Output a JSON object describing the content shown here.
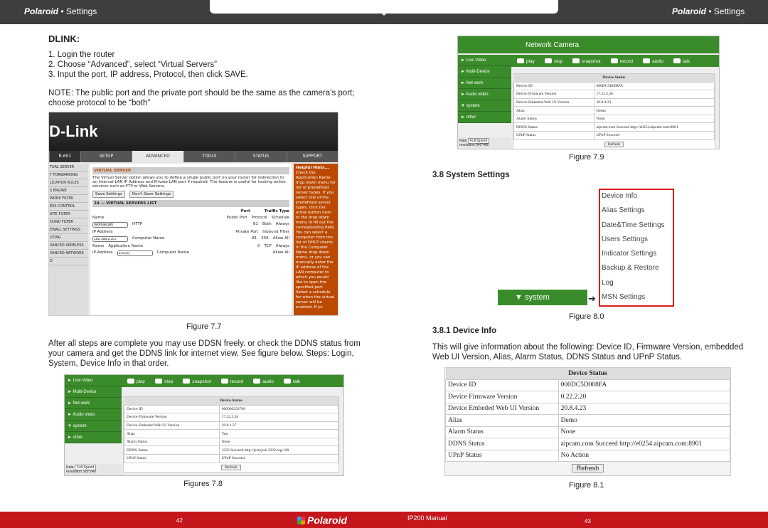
{
  "header": {
    "brand_left": "Polaroid",
    "settings_left": "Settings",
    "brand_right": "Polaroid",
    "settings_right": "Settings"
  },
  "left": {
    "title": "DLINK:",
    "steps": [
      "1. Login the router",
      "2. Choose “Advanced”, select “Virtual Servers”",
      "3. Input the port, IP address, Protocol, then click SAVE."
    ],
    "note": "NOTE: The public port and the private port should be the same as the camera’s port; choose protocol to be “both”",
    "fig77_caption": "Figure 7.7",
    "para": "After all steps are complete you may use DDSN freely. or check the DDNS status from your camera and get the DDNS link for internet view. See figure below. Steps: Login, System, Device Info in that order.",
    "fig78_caption": "Figures 7.8"
  },
  "dlink": {
    "logo": "D-Link",
    "model": "R-601",
    "nav": [
      "SETUP",
      "ADVANCED",
      "TOOLS",
      "STATUS",
      "SUPPORT"
    ],
    "side": [
      "TUAL SERVER",
      "T FORWARDING",
      "LICATION RULES",
      "S ENGINE",
      "WORK FILTER",
      "ESS CONTROL",
      "SITE FILTER",
      "OUND FILTER",
      "EWALL SETTINGS",
      "UTING",
      "VANCED WIRELESS",
      "VANCED NETWORK",
      "D"
    ],
    "section": "VIRTUAL SERVER",
    "desc": "The Virtual Server option allows you to define a single public port on your router for redirection to an internal LAN IP Address and Private LAN port if required. The feature is useful for hosting online services such as FTP or Web Servers.",
    "save_btn": "Save Settings",
    "dont_btn": "Don't Save Settings",
    "list_title": "24 — VIRTUAL SERVERS LIST",
    "col_port": "Port",
    "col_traffic": "Traffic Type",
    "name_label": "Name",
    "name_value": "rivomaxcam",
    "http": "HTTP",
    "ip_label": "IP Address",
    "ip_value": "192.168.0.107",
    "ip_value2": "0.0.0.0",
    "computer_name": "Computer Name",
    "application_name": "Application Name",
    "public_port": "Public Port",
    "private_port": "Private Port",
    "protocol": "Protocol",
    "schedule": "Schedule",
    "inbound": "Inbound Filter",
    "port_81": "81",
    "port_0": "0",
    "proto_both": "Both",
    "proto_tcp": "TCP",
    "proto_num": "256",
    "sched_always": "Always",
    "allow_all": "Allow All",
    "hints_title": "Helpful Hints...",
    "hints": "Check the Application Name drop down menu for list of predefined server types. If you select one of the predefined server types, click the arrow button next to the drop down menu to fill out the corresponding field. You can select a computer from the list of DHCP clients in the Computer Name drop down menu, or you can manually enter the IP address of the LAN computer to which you would like to open the specified port. Select a schedule for when the virtual server will be enabled. If yo"
  },
  "right": {
    "fig79_caption": "Figure 7.9",
    "sys_heading": "3.8 System Settings",
    "fig80_caption": "Figure 8.0",
    "devinfo_heading": "3.8.1 Device Info",
    "devinfo_para": "This will give information about the following: Device ID, Firmware Version, embedded Web UI Version, Alias, Alarm Status, DDNS Status and UPnP Status.",
    "fig81_caption": "Figure 8.1"
  },
  "camera": {
    "title": "Network Camera",
    "toolbar": [
      "play",
      "stop",
      "snapshot",
      "record",
      "audio",
      "talk"
    ],
    "menu": [
      "► Live Video",
      "► Multi-Device",
      "► Net work",
      "► Audio video",
      "▼ system",
      "► other"
    ],
    "rate_label": "Rate",
    "rate_value": "Full-Speed",
    "resolution_label": "resolution",
    "res_79": "640*480",
    "res_78": "320*240"
  },
  "status_79": {
    "title": "Device Status",
    "rows": [
      [
        "Device ID",
        "000DC5D008FA"
      ],
      [
        "Device Firmware Version",
        "17.22.2.26"
      ],
      [
        "Device Embeded Web UI Version",
        "20.8.4.23"
      ],
      [
        "Alias",
        "Demo"
      ],
      [
        "Alarm Status",
        "None"
      ],
      [
        "DDNS Status",
        "aipcam.com  Succeed  http://e0254.aipcam.com:8901"
      ],
      [
        "UPnP Status",
        "UPnP Succeed"
      ]
    ],
    "refresh": "Refresh"
  },
  "status_78": {
    "title": "Device Status",
    "rows": [
      [
        "Device ID",
        "000000256796"
      ],
      [
        "Device Firmware Version",
        "17.22.2.26"
      ],
      [
        "Device Embeded Web UI Version",
        "20.8.1.37"
      ],
      [
        "Alias",
        "Test"
      ],
      [
        "Alarm Status",
        "None"
      ],
      [
        "DDNS Status",
        "3322 Succeed  http://jerryjwb.3322.org:128"
      ],
      [
        "UPnP Status",
        "UPnP Succeed"
      ]
    ],
    "refresh": "Refresh"
  },
  "system_menu": {
    "button": "▼  system",
    "items": [
      "Device Info",
      "Alias Settings",
      "Date&Time Settings",
      "Users Settings",
      "Indicator Settings",
      "Backup & Restore",
      "Log",
      "MSN Settings"
    ]
  },
  "status_81": {
    "title": "Device Status",
    "rows": [
      [
        "Device ID",
        "000DC5D008FA"
      ],
      [
        "Device Firmware Version",
        "0.22.2.20"
      ],
      [
        "Device Embeded Web UI Version",
        "20.8.4.23"
      ],
      [
        "Alias",
        "Demo"
      ],
      [
        "Alarm Status",
        "None"
      ],
      [
        "DDNS Status",
        "aipcam.com  Succeed  http://e0254.aipcam.com:8901"
      ],
      [
        "UPnP Status",
        "No Action"
      ]
    ],
    "refresh": "Refresh"
  },
  "footer": {
    "page_left": "42",
    "brand": "Polaroid",
    "manual": "IP200 Manual",
    "page_right": "43"
  }
}
